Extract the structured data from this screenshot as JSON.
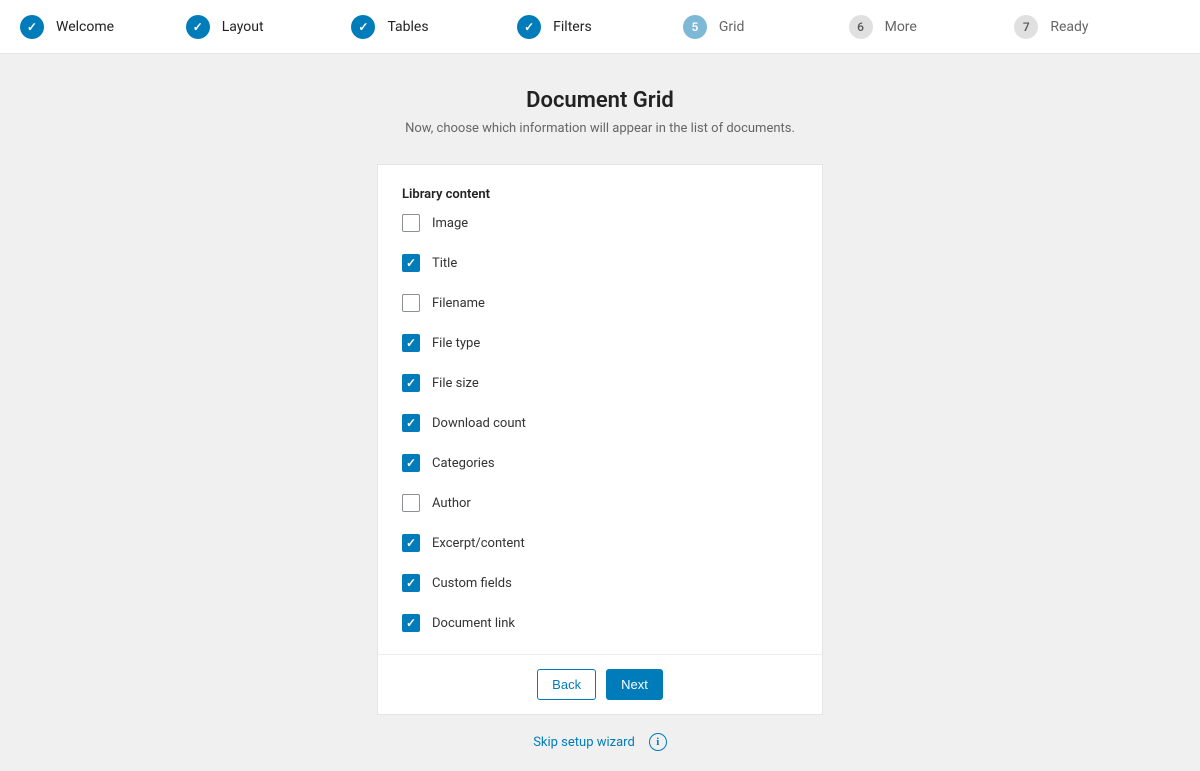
{
  "stepper": {
    "steps": [
      {
        "num": "1",
        "label": "Welcome",
        "state": "done"
      },
      {
        "num": "2",
        "label": "Layout",
        "state": "done"
      },
      {
        "num": "3",
        "label": "Tables",
        "state": "done"
      },
      {
        "num": "4",
        "label": "Filters",
        "state": "done"
      },
      {
        "num": "5",
        "label": "Grid",
        "state": "current"
      },
      {
        "num": "6",
        "label": "More",
        "state": "future"
      },
      {
        "num": "7",
        "label": "Ready",
        "state": "future"
      }
    ]
  },
  "header": {
    "title": "Document Grid",
    "subtitle": "Now, choose which information will appear in the list of documents."
  },
  "section": {
    "label": "Library content",
    "options": [
      {
        "label": "Image",
        "checked": false
      },
      {
        "label": "Title",
        "checked": true
      },
      {
        "label": "Filename",
        "checked": false
      },
      {
        "label": "File type",
        "checked": true
      },
      {
        "label": "File size",
        "checked": true
      },
      {
        "label": "Download count",
        "checked": true
      },
      {
        "label": "Categories",
        "checked": true
      },
      {
        "label": "Author",
        "checked": false
      },
      {
        "label": "Excerpt/content",
        "checked": true
      },
      {
        "label": "Custom fields",
        "checked": true
      },
      {
        "label": "Document link",
        "checked": true
      }
    ]
  },
  "footer": {
    "back": "Back",
    "next": "Next",
    "skip": "Skip setup wizard"
  }
}
